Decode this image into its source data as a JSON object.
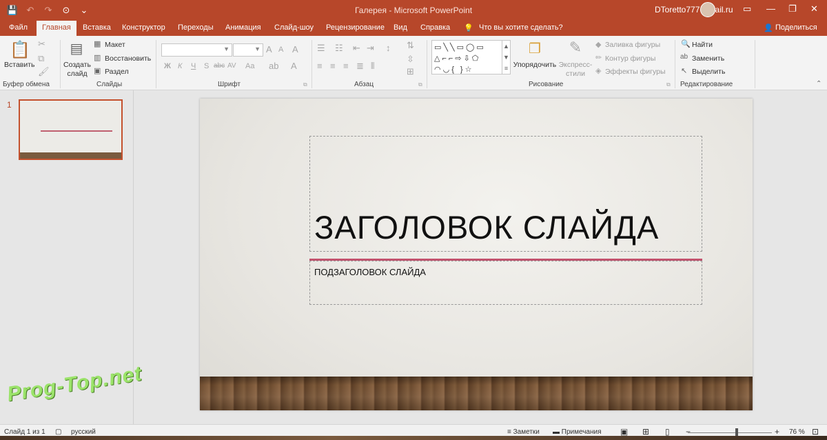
{
  "window": {
    "title": "Галерея  -  Microsoft PowerPoint",
    "user": "DToretto777@mail.ru",
    "controls": {
      "minimize": "—",
      "restore": "❐",
      "close": "✕"
    }
  },
  "qat": {
    "save": "💾",
    "undo": "↶",
    "redo": "↷",
    "start": "⊙",
    "more": "⌄"
  },
  "tabs": [
    {
      "label": "Файл"
    },
    {
      "label": "Главная"
    },
    {
      "label": "Вставка"
    },
    {
      "label": "Конструктор"
    },
    {
      "label": "Переходы"
    },
    {
      "label": "Анимация"
    },
    {
      "label": "Слайд-шоу"
    },
    {
      "label": "Рецензирование"
    },
    {
      "label": "Вид"
    },
    {
      "label": "Справка"
    }
  ],
  "tell_me": {
    "icon": "💡",
    "placeholder": "Что вы хотите сделать?"
  },
  "share": {
    "icon": "👤",
    "label": "Поделиться"
  },
  "ribbon": {
    "clipboard": {
      "paste": "Вставить",
      "group": "Буфер обмена"
    },
    "slides": {
      "new_slide_1": "Создать",
      "new_slide_2": "слайд",
      "layout": "Макет",
      "reset": "Восстановить",
      "section": "Раздел",
      "group": "Слайды"
    },
    "font": {
      "group": "Шрифт",
      "bold": "Ж",
      "italic": "К",
      "underline": "Ч",
      "shadow": "S",
      "strike": "abc",
      "spacing": "AV",
      "case": "Aa",
      "grow": "A",
      "shrink": "A",
      "clear": "A",
      "color": "A"
    },
    "paragraph": {
      "group": "Абзац"
    },
    "drawing": {
      "arrange": "Упорядочить",
      "quick_styles_1": "Экспресс-",
      "quick_styles_2": "стили",
      "fill": "Заливка фигуры",
      "outline": "Контур фигуры",
      "effects": "Эффекты фигуры",
      "group": "Рисование"
    },
    "editing": {
      "find": "Найти",
      "replace": "Заменить",
      "select": "Выделить",
      "group": "Редактирование"
    }
  },
  "thumbnails": [
    {
      "number": "1"
    }
  ],
  "slide": {
    "title": "ЗАГОЛОВОК СЛАЙДА",
    "subtitle": "ПОДЗАГОЛОВОК СЛАЙДА"
  },
  "statusbar": {
    "slide_info": "Слайд 1 из 1",
    "language": "русский",
    "notes": "Заметки",
    "comments": "Примечания",
    "zoom": "76 %"
  },
  "watermark": "Prog-Top.net",
  "colors": {
    "accent": "#b7472a",
    "title_rule": "#c2536e"
  }
}
